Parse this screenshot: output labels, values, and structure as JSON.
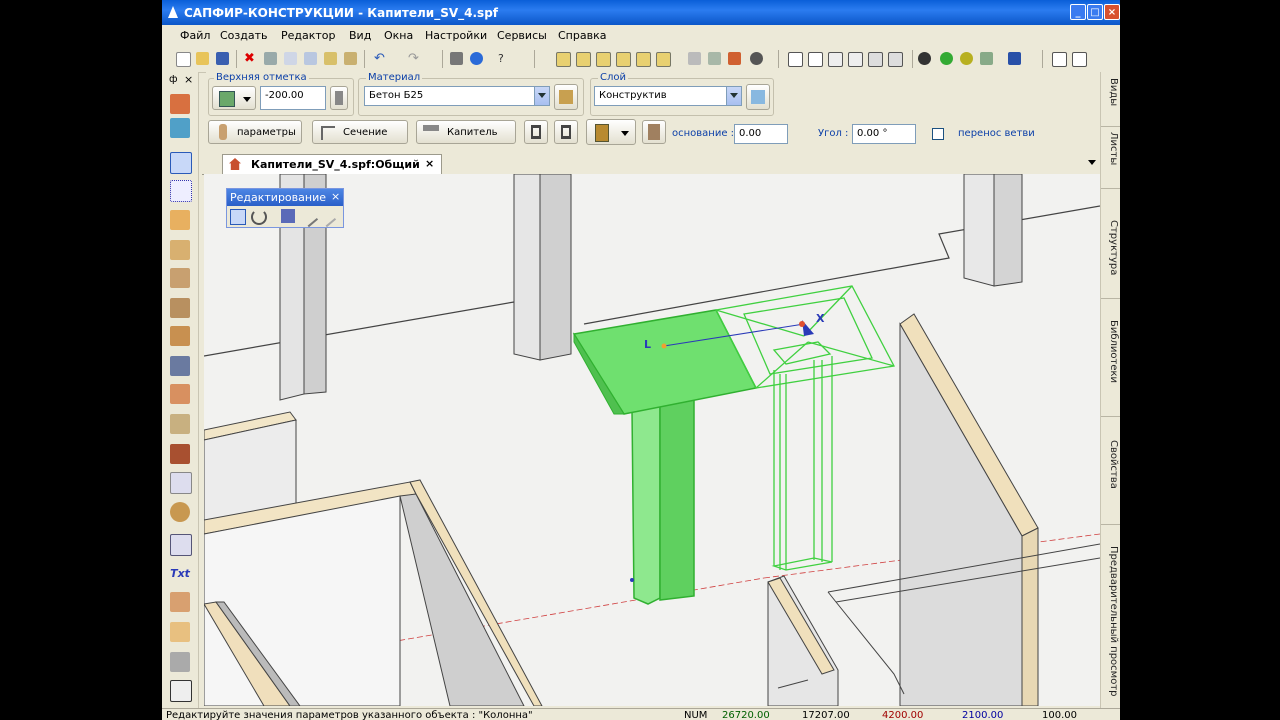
{
  "window": {
    "title": "САПФИР-КОНСТРУКЦИИ - Капители_SV_4.spf",
    "min": "_",
    "max": "□",
    "close": "×"
  },
  "menu": [
    "Файл",
    "Создать",
    "Редактор",
    "Вид",
    "Окна",
    "Настройки",
    "Сервисы",
    "Справка"
  ],
  "props": {
    "top_mark_label": "Верхняя отметка",
    "top_mark_value": "-200.00",
    "material_label": "Материал",
    "material_value": "Бетон Б25",
    "layer_label": "Слой",
    "layer_value": "Конструктив",
    "btn_params": "параметры",
    "btn_section": "Сечение",
    "btn_capital": "Капитель",
    "base_label": "основание :",
    "base_value": "0.00",
    "angle_label": "Угол :",
    "angle_value": "0.00 °",
    "branch_label": "перенос ветви"
  },
  "left_panel": {
    "pin": "ф",
    "close": "×"
  },
  "tab": {
    "label": "Капители_SV_4.spf:Общий вид",
    "close": "×"
  },
  "palette": {
    "title": "Редактирование",
    "close": "×"
  },
  "right_tabs": [
    "Виды",
    "Листы",
    "Структура",
    "Библиотеки",
    "Свойства",
    "Предварительный просмотр"
  ],
  "viewport": {
    "axis_x": "X",
    "axis_l": "L"
  },
  "left_tools": [
    "select",
    "grid",
    "wall",
    "slab",
    "column",
    "beam",
    "door",
    "window",
    "roof",
    "stair",
    "capital",
    "room",
    "object",
    "dimension",
    "text",
    "line",
    "hand",
    "hatch",
    "axes"
  ],
  "status": {
    "message": "Редактируйте значения параметров указанного объекта : \"Колонна\"",
    "num": "NUM",
    "x": "26720.00",
    "y": "17207.00",
    "z": "4200.00",
    "step": "2100.00",
    "scale": "100.00"
  },
  "colors": {
    "accent": "#0a5fd8",
    "selection": "#4fe04f",
    "wall": "#f0e4c8"
  }
}
